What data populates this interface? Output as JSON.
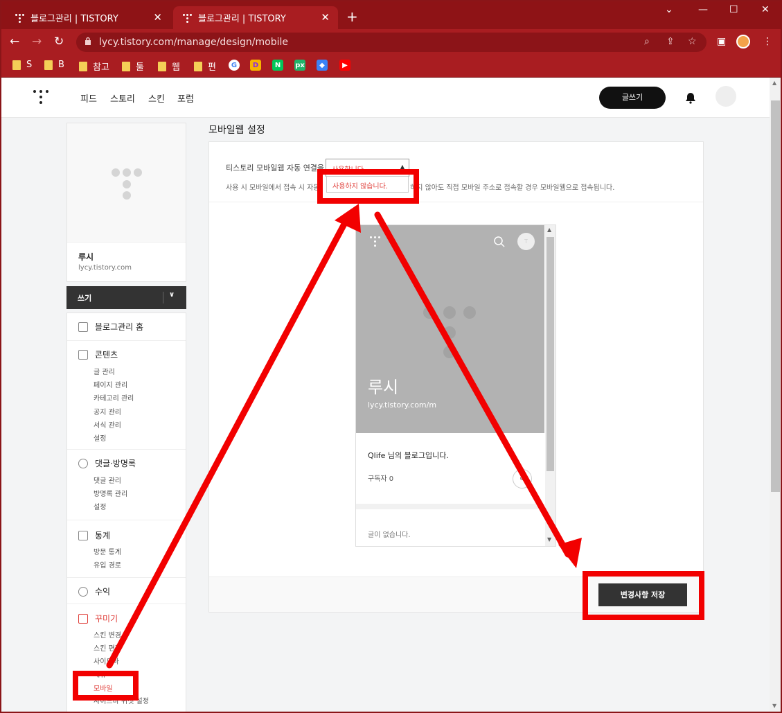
{
  "browser": {
    "tabs": [
      {
        "title": "블로그관리 | TISTORY"
      },
      {
        "title": "블로그관리 | TISTORY"
      }
    ],
    "url": "lycy.tistory.com/manage/design/mobile",
    "bookmarks": [
      "S",
      "B",
      "참고",
      "툴",
      "웹",
      "편"
    ],
    "bookmark_apps": [
      {
        "name": "google-icon",
        "glyph": "G",
        "color": "#ffffff",
        "fg": "#4285f4"
      },
      {
        "name": "d-app-icon",
        "glyph": "D",
        "color": "#f7b500",
        "fg": "#8b2be2"
      },
      {
        "name": "naver-icon",
        "glyph": "N",
        "color": "#03c75a",
        "fg": "#ffffff"
      },
      {
        "name": "px-icon",
        "glyph": "px",
        "color": "#20b46a",
        "fg": "#ffffff"
      },
      {
        "name": "gem-icon",
        "glyph": "◆",
        "color": "#3b82f6",
        "fg": "#ffffff"
      },
      {
        "name": "youtube-icon",
        "glyph": "▶",
        "color": "#ff0000",
        "fg": "#ffffff"
      }
    ]
  },
  "header": {
    "nav": [
      "피드",
      "스토리",
      "스킨",
      "포럼"
    ],
    "write_button": "글쓰기"
  },
  "sidebar": {
    "blog_name": "루시",
    "blog_url": "lycy.tistory.com",
    "write_label": "쓰기",
    "home": "블로그관리 홈",
    "sections": [
      {
        "title": "콘텐츠",
        "items": [
          "글 관리",
          "페이지 관리",
          "카테고리 관리",
          "공지 관리",
          "서식 관리",
          "설정"
        ]
      },
      {
        "title": "댓글·방명록",
        "items": [
          "댓글 관리",
          "방명록 관리",
          "설정"
        ]
      },
      {
        "title": "통계",
        "items": [
          "방문 통계",
          "유입 경로"
        ]
      },
      {
        "title": "수익",
        "items": []
      },
      {
        "title": "꾸미기",
        "items": [
          "스킨 변경",
          "스킨 편집",
          "사이드바",
          "메뉴",
          "모바일",
          "사이드바 위젯 설정"
        ]
      }
    ]
  },
  "main": {
    "title": "모바일웹 설정",
    "setting_label": "티스토리 모바일웹 자동 연결을",
    "select_value": "사용합니다",
    "dropdown_option": "사용하지 않습니다.",
    "desc_start": "사용 시 모바일에서 접속 시 자동",
    "desc_end": "하지 않아도 직접 모바일 주소로 접속할 경우 모바일웹으로 접속됩니다.",
    "save_button": "변경사항 저장"
  },
  "preview": {
    "blog_name": "루시",
    "blog_url": "lycy.tistory.com/m",
    "avatar_letter": "T",
    "description": "Qlife 님의 블로그입니다.",
    "subscribers": "구독자 0",
    "empty": "글이 없습니다."
  },
  "colors": {
    "accent": "#e0413c",
    "annotation": "#f20000",
    "chrome": "#a91d21"
  }
}
